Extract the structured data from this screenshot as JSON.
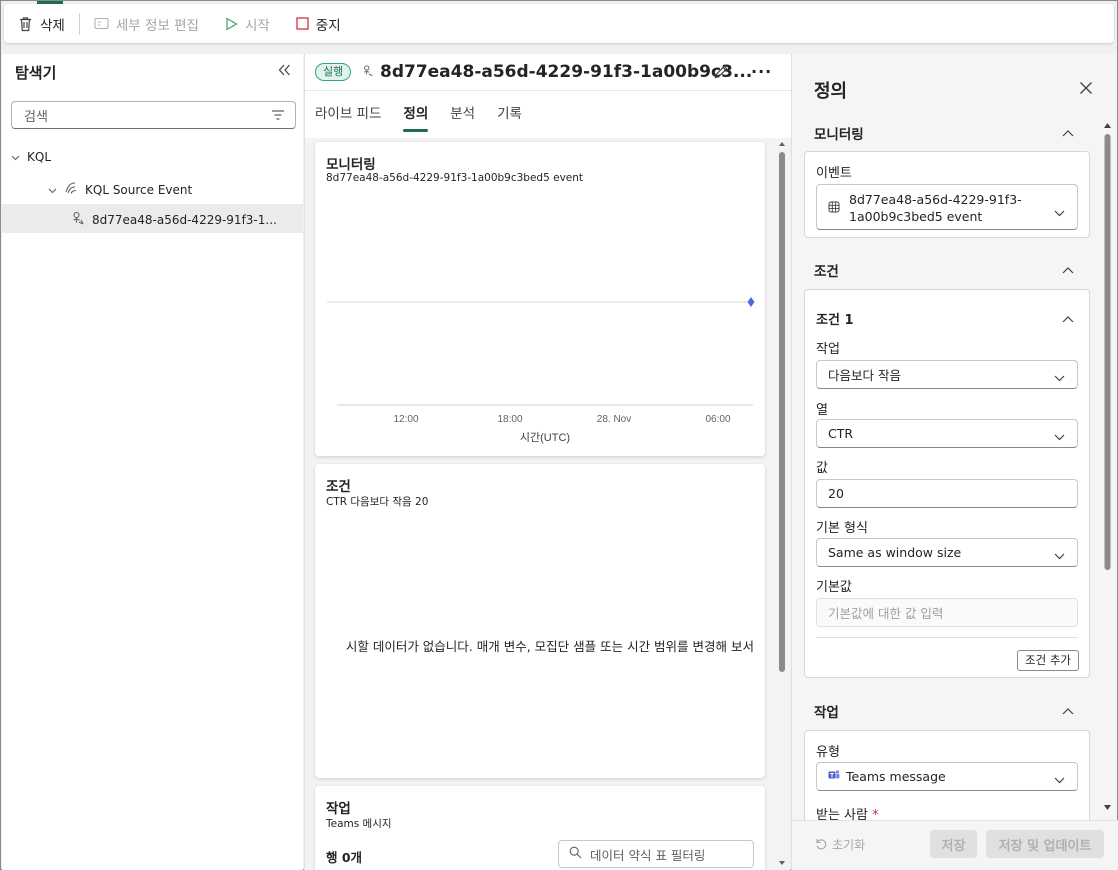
{
  "toolbar": {
    "delete": "삭제",
    "edit_details": "세부 정보 편집",
    "start": "시작",
    "stop": "중지"
  },
  "explorer": {
    "title": "탐색기",
    "search_placeholder": "검색",
    "tree": [
      {
        "label": "KQL"
      },
      {
        "label": "KQL Source Event"
      },
      {
        "label": "8d77ea48-a56d-4229-91f3-1..."
      }
    ]
  },
  "item": {
    "status_badge": "실행",
    "title": "8d77ea48-a56d-4229-91f3-1a00b9c3...",
    "tabs": [
      "라이브 피드",
      "정의",
      "분석",
      "기록"
    ],
    "active_tab": "정의"
  },
  "monitoring_card": {
    "title": "모니터링",
    "subtitle": "8d77ea48-a56d-4229-91f3-1a00b9c3bed5 event"
  },
  "chart_data": {
    "type": "line",
    "x_ticks": [
      "12:00",
      "18:00",
      "28. Nov",
      "06:00"
    ],
    "xlabel": "시간(UTC)",
    "series": [
      {
        "values": [
          {
            "x": "06:30",
            "y": 0
          }
        ]
      }
    ],
    "grid": false,
    "accent": "#4a6bd6"
  },
  "condition_card": {
    "title": "조건",
    "subtitle": "CTR 다음보다 작음 20",
    "empty_message": "시할 데이터가 없습니다. 매개 변수, 모집단 샘플 또는 시간 범위를 변경해 보서"
  },
  "action_card": {
    "title": "작업",
    "subtitle": "Teams 메시지",
    "rows": "행 0개",
    "filter_placeholder": "데이터 약식 표 필터링"
  },
  "panel": {
    "title": "정의",
    "monitoring": {
      "label": "모니터링",
      "event_label": "이벤트",
      "event_value_line1": "8d77ea48-a56d-4229-91f3-",
      "event_value_line2": "1a00b9c3bed5 event"
    },
    "condition": {
      "label": "조건",
      "cond1_label": "조건 1",
      "operation_label": "작업",
      "operation_value": "다음보다 작음",
      "column_label": "열",
      "column_value": "CTR",
      "value_label": "값",
      "value_value": "20",
      "default_type_label": "기본 형식",
      "default_type_value": "Same as window size",
      "default_value_label": "기본값",
      "default_value_placeholder": "기본값에 대한 값 입력",
      "add_condition": "조건 추가"
    },
    "action": {
      "label": "작업",
      "type_label": "유형",
      "type_value": "Teams message",
      "recipient_label": "받는 사람",
      "required_mark": "*"
    },
    "footer": {
      "reset": "초기화",
      "save": "저장",
      "save_update": "저장 및 업데이트"
    }
  }
}
